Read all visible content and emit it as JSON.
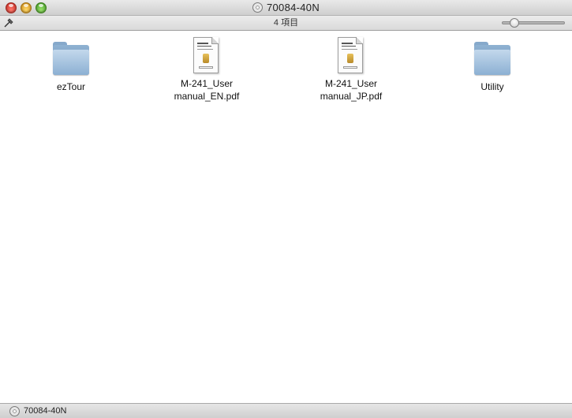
{
  "window": {
    "title": "70084-40N",
    "title_icon": "disc-icon"
  },
  "toolbar": {
    "item_count": "4 項目",
    "icon_size_slider_level": 0.15
  },
  "items": [
    {
      "name": "ezTour",
      "kind": "folder",
      "icon": "folder-icon"
    },
    {
      "name": "M-241_User\nmanual_EN.pdf",
      "kind": "pdf",
      "icon": "pdf-document-icon"
    },
    {
      "name": "M-241_User\nmanual_JP.pdf",
      "kind": "pdf",
      "icon": "pdf-document-icon"
    },
    {
      "name": "Utility",
      "kind": "folder",
      "icon": "folder-icon"
    }
  ],
  "pathbar": {
    "label": "70084-40N",
    "icon": "disc-icon"
  },
  "colors": {
    "folder_blue": "#8cb0d3",
    "titlebar": "#dcdcdc",
    "close": "#e0443a",
    "minimize": "#e9a92b",
    "zoom": "#5bb534"
  }
}
